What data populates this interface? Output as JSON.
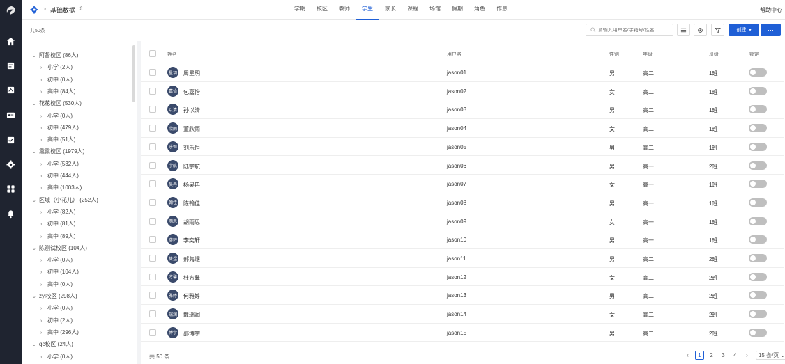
{
  "header": {
    "breadcrumb_title": "基础数据",
    "help": "帮助中心",
    "tabs": [
      "学期",
      "校区",
      "教师",
      "学生",
      "家长",
      "课程",
      "场馆",
      "假期",
      "角色",
      "作息"
    ],
    "active_tab_index": 3
  },
  "toolbar": {
    "count": "共50条",
    "search_placeholder": "请输入用户名/学籍号/姓名",
    "create_label": "创建",
    "more_label": "···"
  },
  "tree": {
    "nodes": [
      {
        "label": "阿督校区 (86人)",
        "level": 0,
        "expanded": true
      },
      {
        "label": "小学 (2人)",
        "level": 1
      },
      {
        "label": "初中 (0人)",
        "level": 1
      },
      {
        "label": "高中 (84人)",
        "level": 1
      },
      {
        "label": "花花校区 (530人)",
        "level": 0,
        "expanded": true
      },
      {
        "label": "小学 (0人)",
        "level": 1
      },
      {
        "label": "初中 (479人)",
        "level": 1
      },
      {
        "label": "高中 (51人)",
        "level": 1
      },
      {
        "label": "熏熏校区 (1979人)",
        "level": 0,
        "expanded": true
      },
      {
        "label": "小学 (532人)",
        "level": 1
      },
      {
        "label": "初中 (444人)",
        "level": 1
      },
      {
        "label": "高中 (1003人)",
        "level": 1
      },
      {
        "label": "区域（小花儿） (252人)",
        "level": 0,
        "expanded": true
      },
      {
        "label": "小学 (82人)",
        "level": 1
      },
      {
        "label": "初中 (81人)",
        "level": 1
      },
      {
        "label": "高中 (89人)",
        "level": 1
      },
      {
        "label": "陈测试校区 (104人)",
        "level": 0,
        "expanded": true
      },
      {
        "label": "小学 (0人)",
        "level": 1
      },
      {
        "label": "初中 (104人)",
        "level": 1
      },
      {
        "label": "高中 (0人)",
        "level": 1
      },
      {
        "label": "zyl校区 (298人)",
        "level": 0,
        "expanded": true
      },
      {
        "label": "小学 (0人)",
        "level": 1
      },
      {
        "label": "初中 (2人)",
        "level": 1
      },
      {
        "label": "高中 (296人)",
        "level": 1
      },
      {
        "label": "qc校区 (24人)",
        "level": 0,
        "expanded": true
      },
      {
        "label": "小学 (0人)",
        "level": 1
      }
    ]
  },
  "table": {
    "columns": [
      "姓名",
      "用户名",
      "性别",
      "年级",
      "班级",
      "锁定"
    ],
    "rows": [
      {
        "avatar": "星玥",
        "name": "周星玥",
        "username": "jason01",
        "gender": "男",
        "grade": "高二",
        "class": "1班"
      },
      {
        "avatar": "嘉怡",
        "name": "包嘉怡",
        "username": "jason02",
        "gender": "女",
        "grade": "高二",
        "class": "1班"
      },
      {
        "avatar": "以清",
        "name": "孙以清",
        "username": "jason03",
        "gender": "男",
        "grade": "高二",
        "class": "1班"
      },
      {
        "avatar": "欣雨",
        "name": "董欣雨",
        "username": "jason04",
        "gender": "女",
        "grade": "高二",
        "class": "1班"
      },
      {
        "avatar": "乐恒",
        "name": "刘乐恒",
        "username": "jason05",
        "gender": "男",
        "grade": "高二",
        "class": "1班"
      },
      {
        "avatar": "宇航",
        "name": "陆宇航",
        "username": "jason06",
        "gender": "男",
        "grade": "高一",
        "class": "2班"
      },
      {
        "avatar": "昊冉",
        "name": "杨昊冉",
        "username": "jason07",
        "gender": "女",
        "grade": "高一",
        "class": "1班"
      },
      {
        "avatar": "翰佳",
        "name": "陈翰佳",
        "username": "jason08",
        "gender": "男",
        "grade": "高一",
        "class": "1班"
      },
      {
        "avatar": "雨思",
        "name": "胡雨思",
        "username": "jason09",
        "gender": "女",
        "grade": "高一",
        "class": "1班"
      },
      {
        "avatar": "奕轩",
        "name": "李奕轩",
        "username": "jason10",
        "gender": "男",
        "grade": "高一",
        "class": "1班"
      },
      {
        "avatar": "隽煜",
        "name": "郝隽煜",
        "username": "jason11",
        "gender": "男",
        "grade": "高二",
        "class": "2班"
      },
      {
        "avatar": "方馨",
        "name": "杜方馨",
        "username": "jason12",
        "gender": "女",
        "grade": "高二",
        "class": "2班"
      },
      {
        "avatar": "雅婷",
        "name": "何雅婷",
        "username": "jason13",
        "gender": "男",
        "grade": "高二",
        "class": "2班"
      },
      {
        "avatar": "瑞润",
        "name": "戴瑞润",
        "username": "jason14",
        "gender": "女",
        "grade": "高二",
        "class": "2班"
      },
      {
        "avatar": "博宇",
        "name": "邵博宇",
        "username": "jason15",
        "gender": "男",
        "grade": "高二",
        "class": "2班"
      }
    ]
  },
  "footer": {
    "total": "共 50 条",
    "pages": [
      "1",
      "2",
      "3",
      "4"
    ],
    "current_page": "1",
    "page_size": "15 条/页"
  }
}
